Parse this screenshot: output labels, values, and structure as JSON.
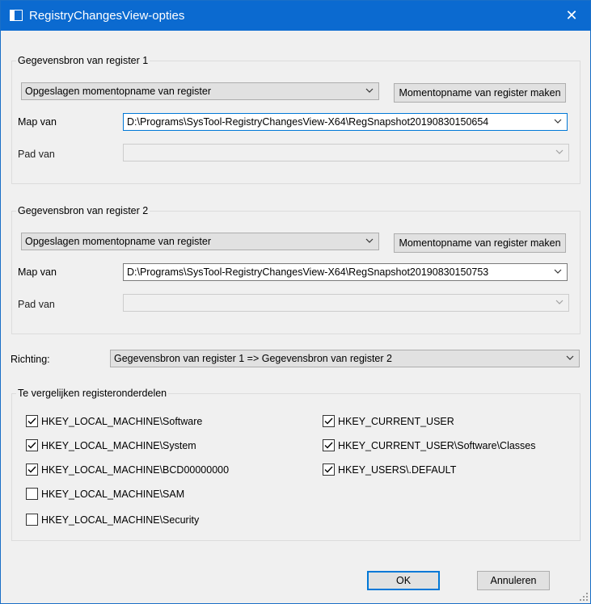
{
  "window": {
    "title": "RegistryChangesView-opties",
    "close_glyph": "✕"
  },
  "source1": {
    "group_title": "Gegevensbron van register 1",
    "type_value": "Opgeslagen momentopname van register",
    "snapshot_button": "Momentopname van register maken",
    "map_label": "Map van",
    "map_value": "D:\\Programs\\SysTool-RegistryChangesView-X64\\RegSnapshot20190830150654",
    "path_label": "Pad van",
    "path_value": ""
  },
  "source2": {
    "group_title": "Gegevensbron van register 2",
    "type_value": "Opgeslagen momentopname van register",
    "snapshot_button": "Momentopname van register maken",
    "map_label": "Map van",
    "map_value": "D:\\Programs\\SysTool-RegistryChangesView-X64\\RegSnapshot20190830150753",
    "path_label": "Pad van",
    "path_value": ""
  },
  "direction": {
    "label": "Richting:",
    "value": "Gegevensbron van register 1 => Gegevensbron van register 2"
  },
  "compare": {
    "group_title": "Te vergelijken registeronderdelen",
    "left": [
      {
        "label": "HKEY_LOCAL_MACHINE\\Software",
        "checked": true
      },
      {
        "label": "HKEY_LOCAL_MACHINE\\System",
        "checked": true
      },
      {
        "label": "HKEY_LOCAL_MACHINE\\BCD00000000",
        "checked": true
      },
      {
        "label": "HKEY_LOCAL_MACHINE\\SAM",
        "checked": false
      },
      {
        "label": "HKEY_LOCAL_MACHINE\\Security",
        "checked": false
      }
    ],
    "right": [
      {
        "label": "HKEY_CURRENT_USER",
        "checked": true
      },
      {
        "label": "HKEY_CURRENT_USER\\Software\\Classes",
        "checked": true
      },
      {
        "label": "HKEY_USERS\\.DEFAULT",
        "checked": true
      }
    ]
  },
  "buttons": {
    "ok": "OK",
    "cancel": "Annuleren"
  },
  "icons": {
    "app": "window-icon",
    "close": "close-icon",
    "dropdown": "chevron-down-icon",
    "check": "check-icon",
    "grip": "resize-grip-icon"
  },
  "colors": {
    "titlebar": "#0b6ad0",
    "focus": "#0078d7",
    "window_bg": "#f0f0f0"
  }
}
